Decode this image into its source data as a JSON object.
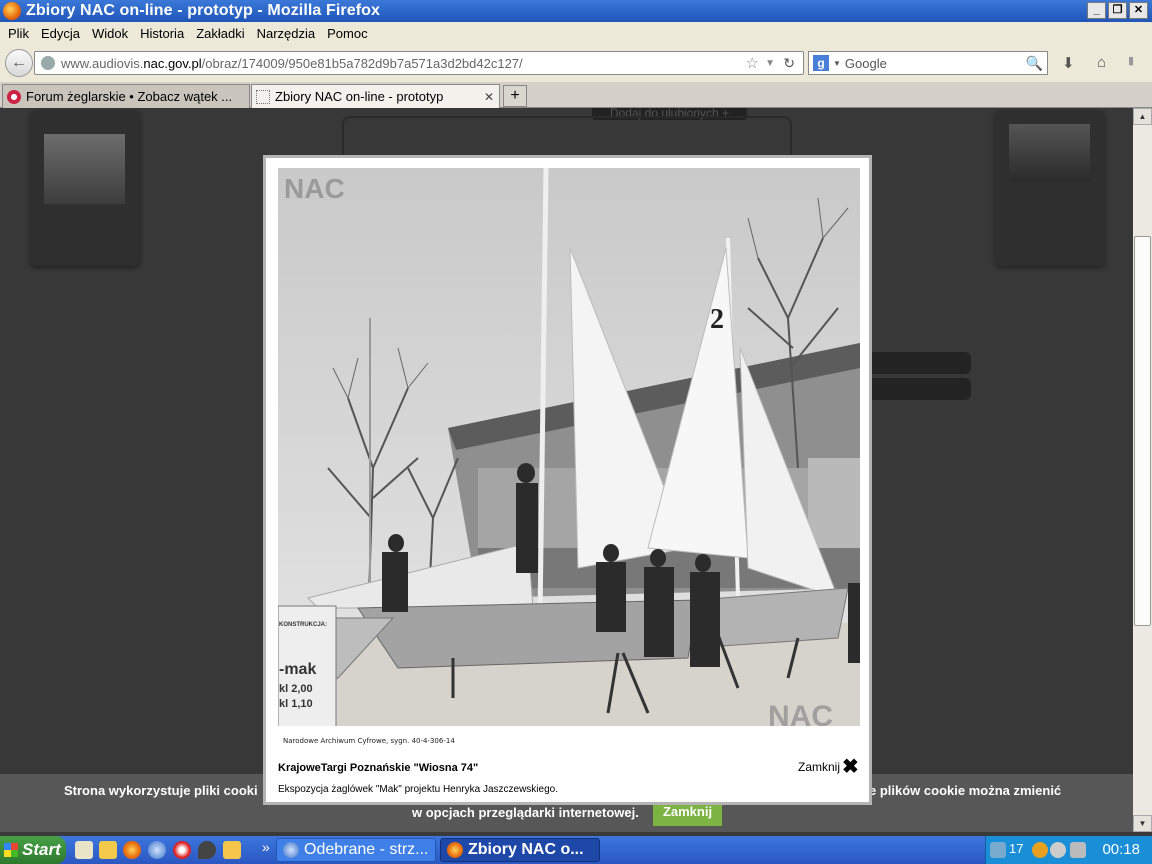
{
  "window": {
    "title": "Zbiory NAC on-line - prototyp - Mozilla Firefox",
    "minimize": "_",
    "restore": "❐",
    "close": "✕"
  },
  "menu": [
    "Plik",
    "Edycja",
    "Widok",
    "Historia",
    "Zakładki",
    "Narzędzia",
    "Pomoc"
  ],
  "nav": {
    "url_prefix": "www.audiovis.",
    "url_domain": "nac.gov.pl",
    "url_path": "/obraz/174009/950e81b5a782d9b7a571a3d2bd42c127/",
    "search_placeholder": "Google",
    "search_engine_letter": "g"
  },
  "tabs": [
    {
      "label": "Forum żeglarskie • Zobacz wątek ...",
      "active": false
    },
    {
      "label": "Zbiory NAC on-line - prototyp",
      "active": true
    }
  ],
  "newtab_label": "+",
  "page": {
    "favorites_button": "Dodaj do ulubionych +"
  },
  "lightbox": {
    "watermark": "NAC",
    "source_caption": "Narodowe Archiwum Cyfrowe, sygn. 40-4-306-14",
    "title": "KrajoweTargi Poznańskie \"Wiosna 74\"",
    "description": "Ekspozycja żaglówek \"Mak\" projektu Henryka Jaszczewskiego.",
    "close_label": "Zamknij",
    "sail_number": "2",
    "sign_lines": [
      "KONSTRUKCJA:",
      "-mak",
      "kl 2,00",
      "kl 1,10"
    ]
  },
  "cookie": {
    "text_left": "Strona wykorzystuje pliki cooki",
    "text_right": "e plików cookie można zmienić",
    "text_line2": "w opcjach przeglądarki internetowej.",
    "button": "Zamknij"
  },
  "taskbar": {
    "start": "Start",
    "overflow": "»",
    "tasks": [
      "Odebrane - strz...",
      "Zbiory NAC o..."
    ],
    "tray_number": "17",
    "clock": "00:18"
  },
  "colors": {
    "titlebar": "#1f56b8",
    "cookie_button": "#7cb342",
    "taskbar": "#2a57c2"
  }
}
